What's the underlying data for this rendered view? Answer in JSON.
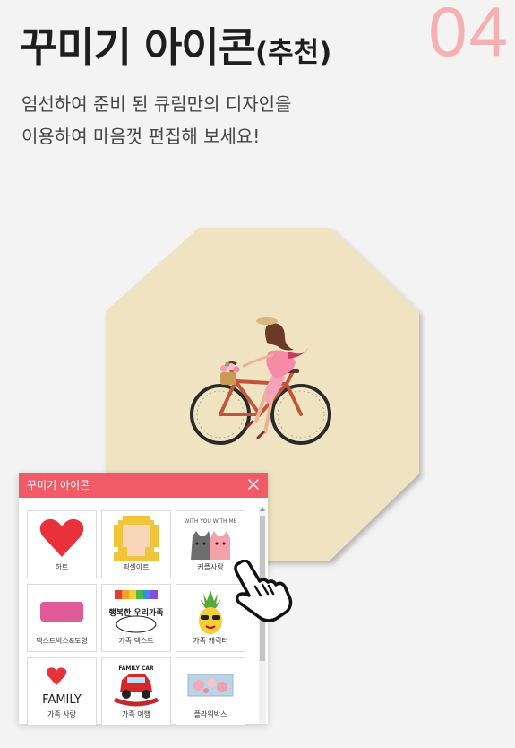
{
  "step_number": "04",
  "title": {
    "main": "꾸미기 아이콘",
    "sub": "(추천)"
  },
  "description": [
    "엄선하여 준비 된 큐림만의 디자인을",
    "이용하여 마음껏 편집해 보세요!"
  ],
  "panel": {
    "title": "꾸미기 아이콘",
    "close_icon": "close-icon",
    "items": [
      {
        "label": "하트",
        "icon": "heart-icon"
      },
      {
        "label": "픽셀아트",
        "icon": "pixel-art-icon"
      },
      {
        "label": "커플사랑",
        "icon": "couple-cats-icon",
        "art_text": "WITH YOU WITH ME"
      },
      {
        "label": "텍스트박스&도형",
        "icon": "text-box-icon"
      },
      {
        "label": "가족 텍스트",
        "icon": "family-text-icon",
        "art_text": "행복한 우리가족"
      },
      {
        "label": "가족 캐릭터",
        "icon": "pineapple-character-icon"
      },
      {
        "label": "가족 사랑",
        "icon": "family-heart-icon",
        "art_text": "FAMILY"
      },
      {
        "label": "가족 여행",
        "icon": "family-car-icon",
        "art_text": "FAMILY CAR"
      },
      {
        "label": "플라워박스",
        "icon": "flower-box-icon"
      }
    ]
  },
  "colors": {
    "accent": "#f15a67",
    "step_number": "#f5b1b1",
    "board": "#efe3c2"
  }
}
